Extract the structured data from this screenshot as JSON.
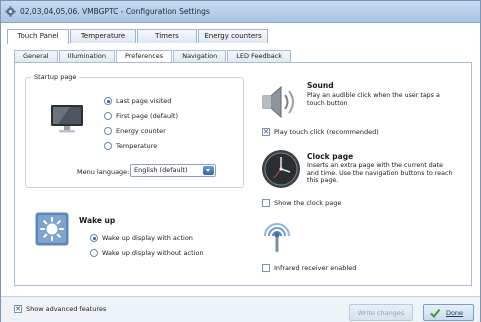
{
  "window": {
    "title": "02,03,04,05,06. VMBGPTC - Configuration Settings"
  },
  "main_tabs": [
    "Touch Panel",
    "Temperature",
    "Timers",
    "Energy counters"
  ],
  "sub_tabs": [
    "General",
    "Illumination",
    "Preferences",
    "Navigation",
    "LED Feedback"
  ],
  "startup": {
    "title": "Startup page",
    "options": [
      "Last page visited",
      "First page (default)",
      "Energy counter",
      "Temperature"
    ],
    "selected": 0,
    "menu_language_label": "Menu language:",
    "menu_language_value": "English (default)"
  },
  "wakeup": {
    "title": "Wake up",
    "options": [
      "Wake up display with action",
      "Wake up display without action"
    ],
    "selected": 0
  },
  "sound": {
    "title": "Sound",
    "description": "Play an audible click when the user taps a touch button",
    "checkbox_label": "Play touch click (recommended)",
    "checked": true
  },
  "clock": {
    "title": "Clock page",
    "description": "Inserts an extra page with the current date and time. Use the navigation buttons to reach this page.",
    "checkbox_label": "Show the clock page",
    "checked": false
  },
  "infrared": {
    "checkbox_label": "Infrared receiver enabled",
    "checked": false
  },
  "footer": {
    "advanced_label": "Show advanced features",
    "advanced_checked": true,
    "write_label": "Write changes",
    "done_label": "Done"
  }
}
